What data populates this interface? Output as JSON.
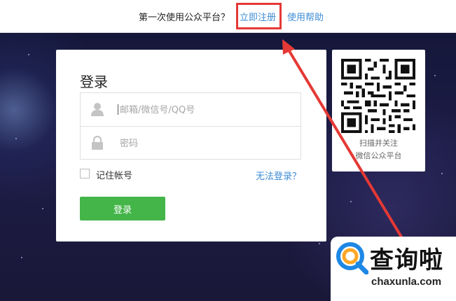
{
  "topbar": {
    "question": "第一次使用公众平台？",
    "register_link": "立即注册",
    "help_link": "使用帮助"
  },
  "login": {
    "title": "登录",
    "account_placeholder": "邮箱/微信号/QQ号",
    "password_placeholder": "密码",
    "remember_label": "记住帐号",
    "forgot_link": "无法登录？",
    "submit_label": "登录"
  },
  "qr": {
    "caption_line1": "扫描并关注",
    "caption_line2": "微信公众平台"
  },
  "watermark": {
    "brand_cn": "查询啦",
    "brand_url": "chaxunla.com"
  },
  "colors": {
    "accent_blue": "#3d8cd6",
    "button_green": "#44b549",
    "annotation_red": "#e53935"
  },
  "icons": {
    "account": "user-icon",
    "password": "lock-icon",
    "logo": "magnifier-logo-icon"
  }
}
